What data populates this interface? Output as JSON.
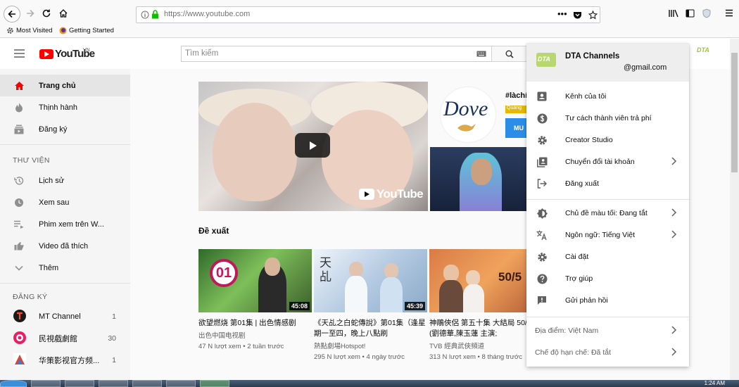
{
  "browser": {
    "url": "https://www.youtube.com",
    "bookmarks": [
      {
        "label": "Most Visited"
      },
      {
        "label": "Getting Started"
      }
    ]
  },
  "youtube": {
    "logo_text": "YouTube",
    "region": "VN",
    "search_placeholder": "Tìm kiếm",
    "brand_color": "#ff0000"
  },
  "sidebar": {
    "primary": [
      {
        "label": "Trang chủ",
        "icon": "home-icon",
        "active": true
      },
      {
        "label": "Thịnh hành",
        "icon": "flame-icon"
      },
      {
        "label": "Đăng ký",
        "icon": "subscriptions-icon"
      }
    ],
    "library_heading": "THƯ VIỆN",
    "library": [
      {
        "label": "Lịch sử",
        "icon": "history-icon"
      },
      {
        "label": "Xem sau",
        "icon": "clock-icon"
      },
      {
        "label": "Phim xem trên W...",
        "icon": "playlist-icon"
      },
      {
        "label": "Video đã thích",
        "icon": "thumbs-up-icon"
      },
      {
        "label": "Thêm",
        "icon": "chevron-down-icon"
      }
    ],
    "subs_heading": "ĐĂNG KÝ",
    "subscriptions": [
      {
        "label": "MT Channel",
        "count": "1",
        "color": "#1a1a1a"
      },
      {
        "label": "民視戲劇館",
        "count": "30",
        "color": "#e91e63"
      },
      {
        "label": "华策影视官方频...",
        "count": "1",
        "color": "#3a7bd5"
      }
    ]
  },
  "main": {
    "ad": {
      "brand": "Dove",
      "tag": "#làchí",
      "badge": "Quảng",
      "cta": "MU"
    },
    "hero_watermark": "YouTube",
    "section_title": "Đề xuất",
    "videos": [
      {
        "title": "欲望燃烧 第01集 | 出色情感剧",
        "channel": "出色中国电视剧",
        "meta": "47 N lượt xem • 2 tuần trước",
        "duration": "45:08",
        "badge": "01"
      },
      {
        "title": "《天乩之白蛇傳說》第01集（逢星期一至四，晚上八點刷",
        "channel": "熱點劇場Hotspot!",
        "meta": "295 N lượt xem • 4 ngày trước",
        "duration": "45:39",
        "badge": "天乩"
      },
      {
        "title": "神鵰俠侶 第五十集 大結局 50/50 (劉德華,陳玉蓮 主演;",
        "channel": "TVB 經典武俠頻道",
        "meta": "313 N lượt xem • 8 tháng trước",
        "duration": "",
        "badge": "50/5"
      }
    ]
  },
  "account_menu": {
    "avatar_text": "DTA",
    "name": "DTA Channels",
    "email": "@gmail.com",
    "items": [
      {
        "label": "Kênh của tôi",
        "icon": "account-box-icon"
      },
      {
        "label": "Tư cách thành viên trả phí",
        "icon": "paid-icon"
      },
      {
        "label": "Creator Studio",
        "icon": "gear-icon"
      },
      {
        "label": "Chuyển đổi tài khoản",
        "icon": "switch-account-icon",
        "chevron": true
      },
      {
        "label": "Đăng xuất",
        "icon": "sign-out-icon"
      }
    ],
    "items2": [
      {
        "label": "Chủ đề màu tối: Đang tắt",
        "icon": "dark-theme-icon",
        "chevron": true
      },
      {
        "label": "Ngôn ngữ: Tiếng Việt",
        "icon": "translate-icon",
        "chevron": true
      },
      {
        "label": "Cài đặt",
        "icon": "settings-icon"
      },
      {
        "label": "Trợ giúp",
        "icon": "help-icon"
      },
      {
        "label": "Gửi phản hồi",
        "icon": "feedback-icon"
      }
    ],
    "items3": [
      {
        "label": "Địa điểm: Việt Nam",
        "chevron": true
      },
      {
        "label": "Chế độ hạn chế: Đã tắt",
        "chevron": true
      }
    ]
  },
  "taskbar": {
    "time": "1:24 AM"
  }
}
